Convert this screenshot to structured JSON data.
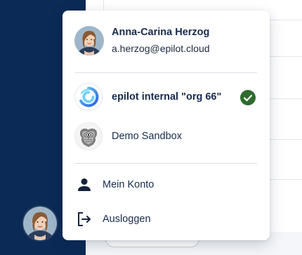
{
  "user": {
    "name": "Anna-Carina Herzog",
    "email": "a.herzog@epilot.cloud",
    "avatar_icon": "user-portrait-avatar"
  },
  "organizations": [
    {
      "label": "epilot internal \"org 66\"",
      "icon": "epilot-logo-icon",
      "active": true
    },
    {
      "label": "Demo Sandbox",
      "icon": "owl-crest-logo-icon",
      "active": false
    }
  ],
  "actions": {
    "account_label": "Mein Konto",
    "account_icon": "person-icon",
    "logout_label": "Ausloggen",
    "logout_icon": "logout-icon"
  },
  "colors": {
    "sidebar": "#0b2a55",
    "text": "#172b4d",
    "check": "#2e6b2e",
    "epilot_blue": "#2f6fe0"
  }
}
